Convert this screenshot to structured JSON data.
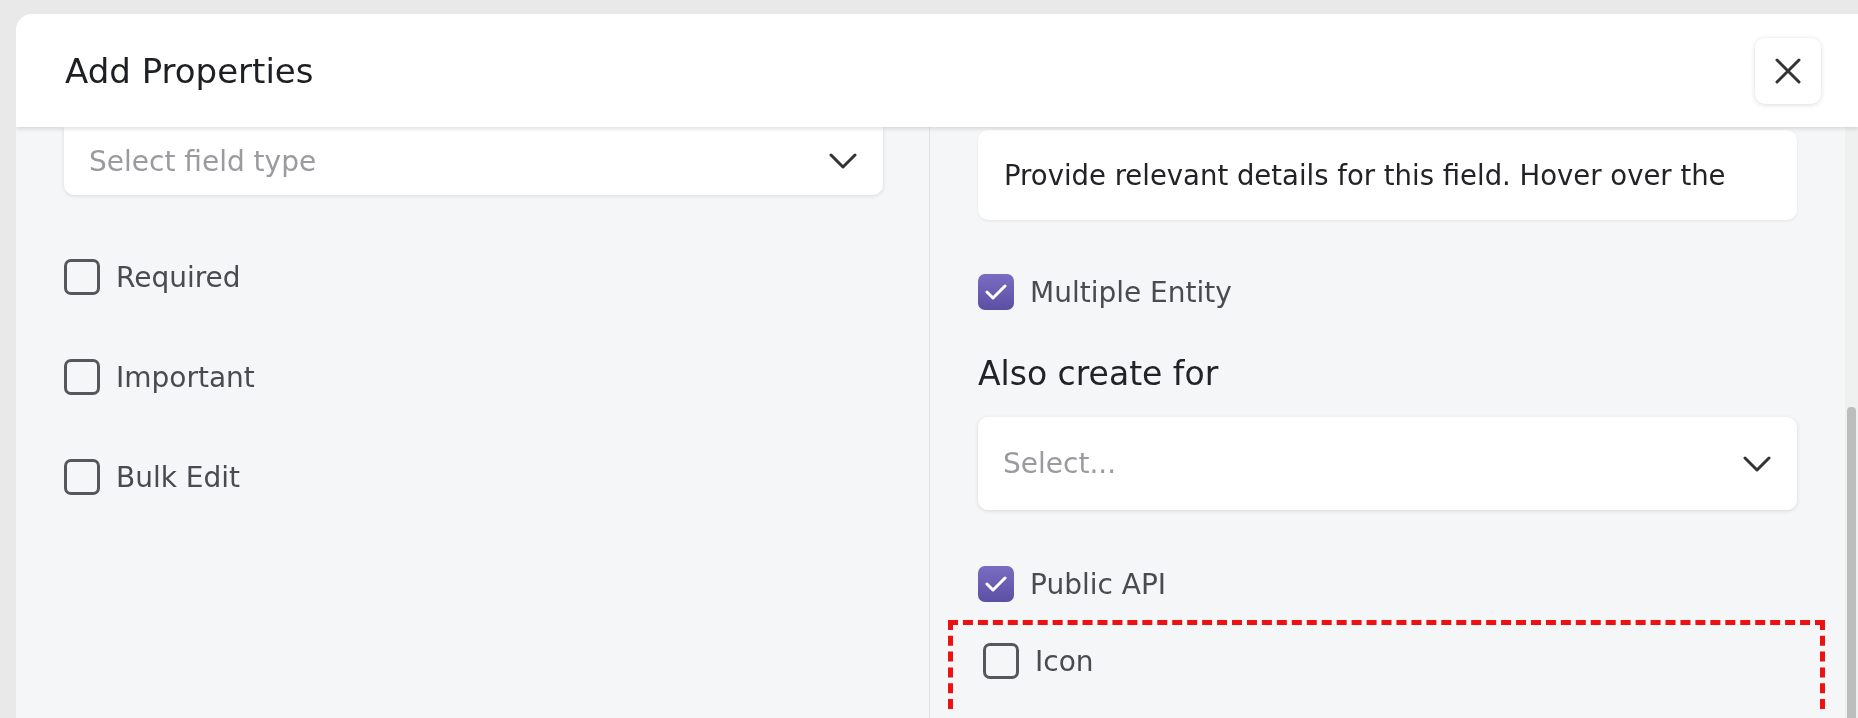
{
  "dialog": {
    "title": "Add Properties"
  },
  "left": {
    "field_type": {
      "placeholder": "Select field type"
    },
    "options": [
      {
        "label": "Required",
        "checked": false
      },
      {
        "label": "Important",
        "checked": false
      },
      {
        "label": "Bulk Edit",
        "checked": false
      }
    ]
  },
  "right": {
    "description": {
      "value": "Provide relevant details for this field. Hover over the"
    },
    "multiple_entity": {
      "label": "Multiple Entity",
      "checked": true
    },
    "also_create_for": {
      "heading": "Also create for",
      "placeholder": "Select..."
    },
    "options": [
      {
        "label": "Public API",
        "checked": true,
        "highlighted": false
      },
      {
        "label": "Icon",
        "checked": false,
        "highlighted": true
      }
    ]
  }
}
